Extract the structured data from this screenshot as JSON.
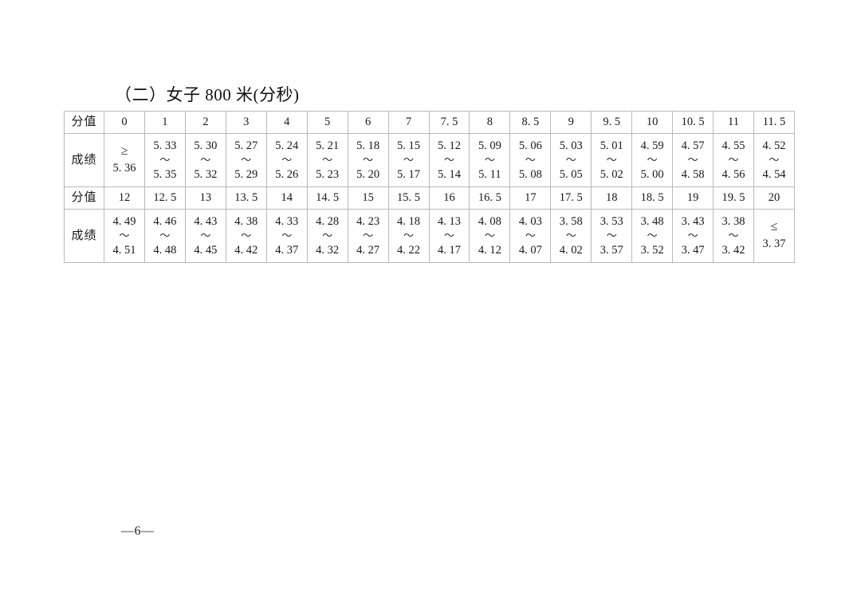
{
  "document": {
    "title": "（二）女子 800 米(分秒)",
    "page_number": "—6—"
  },
  "table": {
    "row_labels": {
      "score_value": "分值",
      "performance": "成绩"
    },
    "sections": [
      {
        "header": {
          "label": "分值",
          "values": [
            "0",
            "1",
            "2",
            "3",
            "4",
            "5",
            "6",
            "7",
            "7. 5",
            "8",
            "8. 5",
            "9",
            "9. 5",
            "10",
            "10. 5",
            "11",
            "11. 5"
          ]
        },
        "body": {
          "label": "成绩",
          "cells": [
            {
              "type": "single",
              "cmp": "≥",
              "value": "5. 36"
            },
            {
              "type": "range",
              "from": "5. 33",
              "tilde": "～",
              "to": "5. 35"
            },
            {
              "type": "range",
              "from": "5. 30",
              "tilde": "～",
              "to": "5. 32"
            },
            {
              "type": "range",
              "from": "5. 27",
              "tilde": "～",
              "to": "5. 29"
            },
            {
              "type": "range",
              "from": "5. 24",
              "tilde": "～",
              "to": "5. 26"
            },
            {
              "type": "range",
              "from": "5. 21",
              "tilde": "～",
              "to": "5. 23"
            },
            {
              "type": "range",
              "from": "5. 18",
              "tilde": "～",
              "to": "5. 20"
            },
            {
              "type": "range",
              "from": "5. 15",
              "tilde": "～",
              "to": "5. 17"
            },
            {
              "type": "range",
              "from": "5. 12",
              "tilde": "～",
              "to": "5. 14"
            },
            {
              "type": "range",
              "from": "5. 09",
              "tilde": "～",
              "to": "5. 11"
            },
            {
              "type": "range",
              "from": "5. 06",
              "tilde": "～",
              "to": "5. 08"
            },
            {
              "type": "range",
              "from": "5. 03",
              "tilde": "～",
              "to": "5. 05"
            },
            {
              "type": "range",
              "from": "5. 01",
              "tilde": "～",
              "to": "5. 02"
            },
            {
              "type": "range",
              "from": "4. 59",
              "tilde": "～",
              "to": "5. 00"
            },
            {
              "type": "range",
              "from": "4. 57",
              "tilde": "～",
              "to": "4. 58"
            },
            {
              "type": "range",
              "from": "4. 55",
              "tilde": "～",
              "to": "4. 56"
            },
            {
              "type": "range",
              "from": "4. 52",
              "tilde": "～",
              "to": "4. 54"
            }
          ]
        }
      },
      {
        "header": {
          "label": "分值",
          "values": [
            "12",
            "12. 5",
            "13",
            "13. 5",
            "14",
            "14. 5",
            "15",
            "15. 5",
            "16",
            "16. 5",
            "17",
            "17. 5",
            "18",
            "18. 5",
            "19",
            "19. 5",
            "20"
          ]
        },
        "body": {
          "label": "成绩",
          "cells": [
            {
              "type": "range",
              "from": "4. 49",
              "tilde": "～",
              "to": "4. 51"
            },
            {
              "type": "range",
              "from": "4. 46",
              "tilde": "～",
              "to": "4. 48"
            },
            {
              "type": "range",
              "from": "4. 43",
              "tilde": "～",
              "to": "4. 45"
            },
            {
              "type": "range",
              "from": "4. 38",
              "tilde": "～",
              "to": "4. 42"
            },
            {
              "type": "range",
              "from": "4. 33",
              "tilde": "～",
              "to": "4. 37"
            },
            {
              "type": "range",
              "from": "4. 28",
              "tilde": "～",
              "to": "4. 32"
            },
            {
              "type": "range",
              "from": "4. 23",
              "tilde": "～",
              "to": "4. 27"
            },
            {
              "type": "range",
              "from": "4. 18",
              "tilde": "～",
              "to": "4. 22"
            },
            {
              "type": "range",
              "from": "4. 13",
              "tilde": "～",
              "to": "4. 17"
            },
            {
              "type": "range",
              "from": "4. 08",
              "tilde": "～",
              "to": "4. 12"
            },
            {
              "type": "range",
              "from": "4. 03",
              "tilde": "～",
              "to": "4. 07"
            },
            {
              "type": "range",
              "from": "3. 58",
              "tilde": "～",
              "to": "4. 02"
            },
            {
              "type": "range",
              "from": "3. 53",
              "tilde": "～",
              "to": "3. 57"
            },
            {
              "type": "range",
              "from": "3. 48",
              "tilde": "～",
              "to": "3. 52"
            },
            {
              "type": "range",
              "from": "3. 43",
              "tilde": "～",
              "to": "3. 47"
            },
            {
              "type": "range",
              "from": "3. 38",
              "tilde": "～",
              "to": "3. 42"
            },
            {
              "type": "single",
              "cmp": "≤",
              "value": "3. 37"
            }
          ]
        }
      }
    ]
  },
  "colors": {
    "border": "#b9b9b9",
    "text": "#16171b",
    "background": "#ffffff"
  }
}
